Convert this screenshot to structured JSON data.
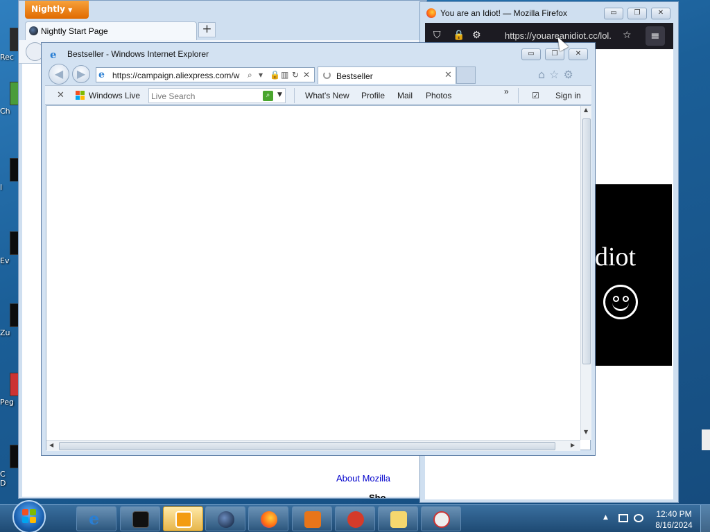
{
  "desktop": {
    "icons": [
      {
        "label": "Rec"
      },
      {
        "label": "Ch"
      },
      {
        "label": "l"
      },
      {
        "label": "Ev"
      },
      {
        "label": "Zu"
      },
      {
        "label": "Peg"
      },
      {
        "label": "C"
      },
      {
        "label": "D"
      }
    ]
  },
  "nightly": {
    "app_button": "Nightly",
    "tab_title": "Nightly Start Page",
    "new_tab": "+",
    "about_link": "About Mozilla",
    "footer_text": "Sho"
  },
  "firefox": {
    "title": "You are an Idiot! — Mozilla Firefox",
    "url": "https://youareanidiot.cc/lol.",
    "page_text": "diot",
    "menu": "≡"
  },
  "ie": {
    "title": "Bestseller - Windows Internet Explorer",
    "url": "https://campaign.aliexpress.com/w",
    "tab_title": "Bestseller",
    "toolbar": {
      "windows_live": "Windows Live",
      "search_placeholder": "Live Search",
      "whats_new": "What's New",
      "profile": "Profile",
      "mail": "Mail",
      "photos": "Photos",
      "more": "»",
      "sign_in": "Sign in"
    }
  },
  "taskbar": {
    "time": "12:40 PM",
    "date": "8/16/2024"
  },
  "colors": {
    "nightly_orange": "#e06a00",
    "link_blue": "#0000cc",
    "taskbar": "#1e4a73"
  }
}
